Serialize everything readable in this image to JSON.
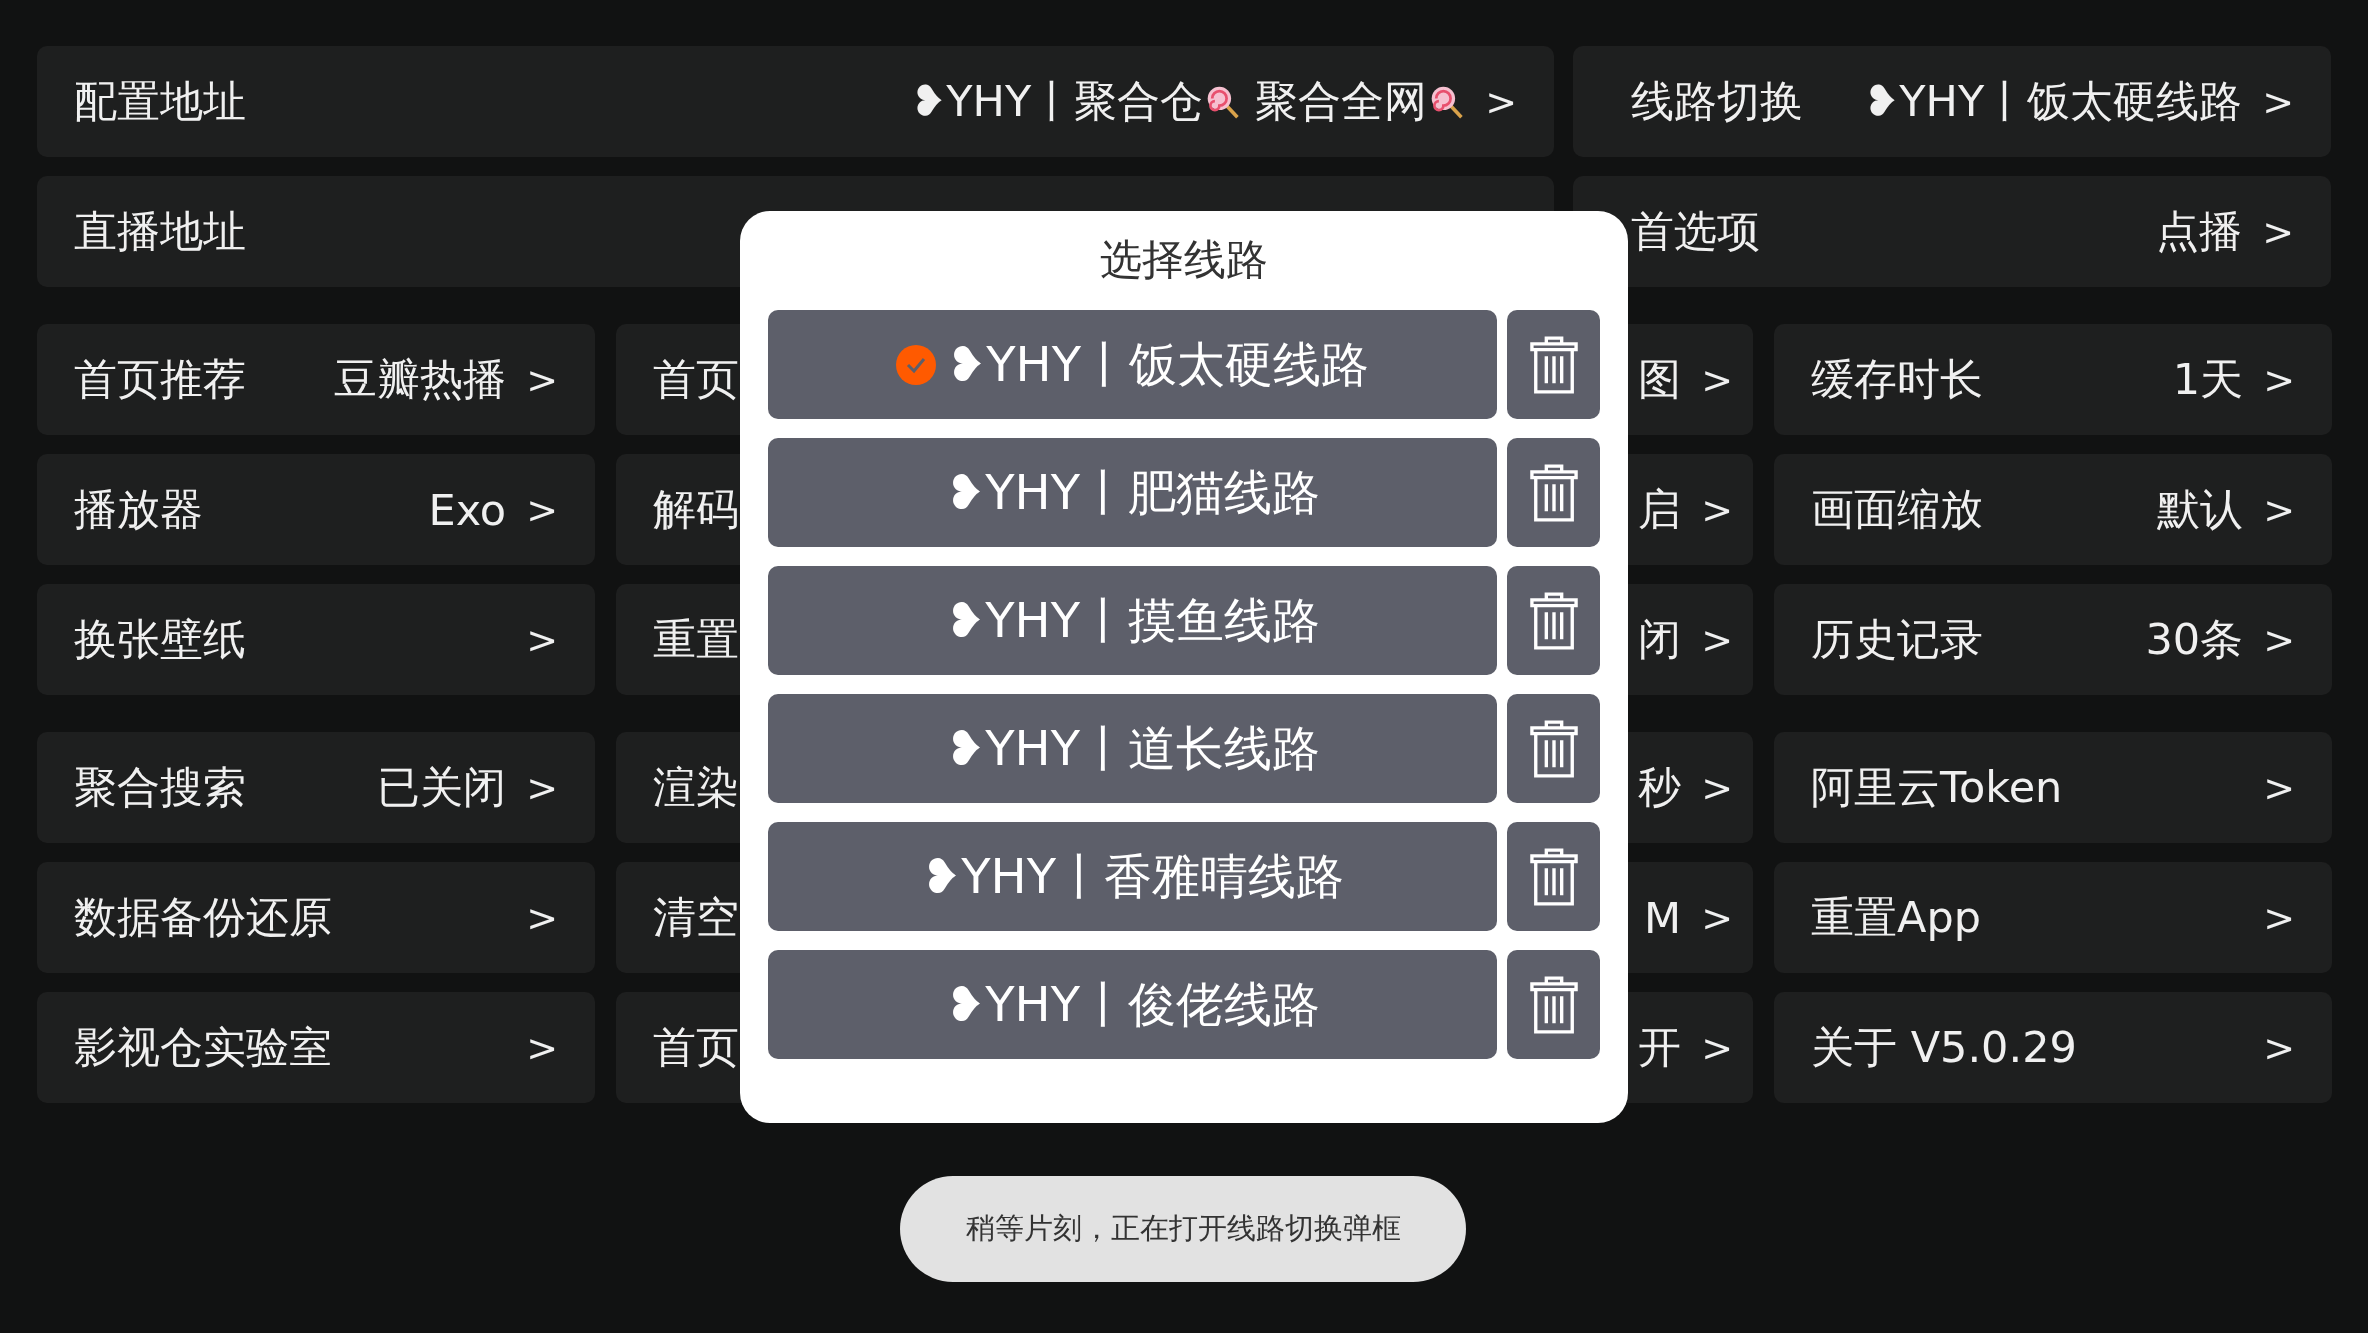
{
  "top_rows": [
    [
      {
        "label": "配置地址",
        "value_parts": [
          "❥YHY丨聚合仓",
          "聚合全网"
        ],
        "arrow": ">"
      },
      {
        "label": "线路切换",
        "value": "❥YHY丨饭太硬线路",
        "arrow": ">"
      }
    ],
    [
      {
        "label": "直播地址"
      },
      {
        "label": "首选项",
        "value": "点播",
        "arrow": ">"
      }
    ]
  ],
  "grid_groups": [
    [
      [
        {
          "label": "首页推荐",
          "value": "豆瓣热播",
          "arrow": ">"
        },
        {
          "label": "首页"
        },
        {
          "value": "图",
          "arrow": ">"
        },
        {
          "label": "缓存时长",
          "value": "1天",
          "arrow": ">"
        }
      ],
      [
        {
          "label": "播放器",
          "value": "Exo",
          "arrow": ">"
        },
        {
          "label": "解码"
        },
        {
          "value": "启",
          "arrow": ">"
        },
        {
          "label": "画面缩放",
          "value": "默认",
          "arrow": ">"
        }
      ],
      [
        {
          "label": "换张壁纸",
          "arrow": ">"
        },
        {
          "label": "重置"
        },
        {
          "value": "闭",
          "arrow": ">"
        },
        {
          "label": "历史记录",
          "value": "30条",
          "arrow": ">"
        }
      ]
    ],
    [
      [
        {
          "label": "聚合搜索",
          "value": "已关闭",
          "arrow": ">"
        },
        {
          "label": "渲染"
        },
        {
          "value": "秒",
          "arrow": ">"
        },
        {
          "label": "阿里云Token",
          "arrow": ">"
        }
      ],
      [
        {
          "label": "数据备份还原",
          "arrow": ">"
        },
        {
          "label": "清空"
        },
        {
          "value": "M",
          "arrow": ">"
        },
        {
          "label": "重置App",
          "arrow": ">"
        }
      ],
      [
        {
          "label": "影视仓实验室",
          "arrow": ">"
        },
        {
          "label": "首页"
        },
        {
          "value": "开",
          "arrow": ">"
        },
        {
          "label": "关于 V5.0.29",
          "arrow": ">"
        }
      ]
    ]
  ],
  "dialog": {
    "title": "选择线路",
    "items": [
      {
        "label": "❥YHY丨饭太硬线路",
        "selected": true
      },
      {
        "label": "❥YHY丨肥猫线路",
        "selected": false
      },
      {
        "label": "❥YHY丨摸鱼线路",
        "selected": false
      },
      {
        "label": "❥YHY丨道长线路",
        "selected": false
      },
      {
        "label": "❥YHY丨香雅晴线路",
        "selected": false
      },
      {
        "label": "❥YHY丨俊佬线路",
        "selected": false
      }
    ]
  },
  "toast": "稍等片刻，正在打开线路切换弹框"
}
